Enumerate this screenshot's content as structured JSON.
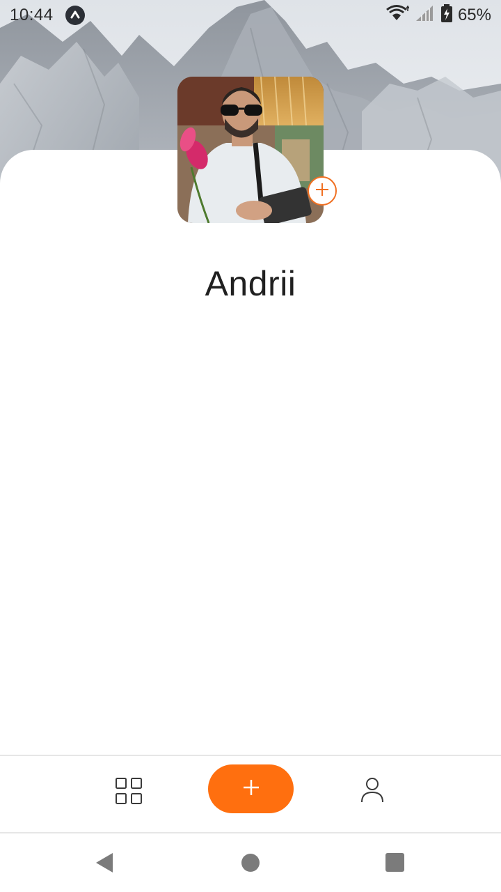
{
  "status_bar": {
    "time": "10:44",
    "battery": "65%",
    "icons": [
      "app-notification-icon",
      "wifi-icon",
      "signal-icon",
      "battery-charging-icon"
    ]
  },
  "profile": {
    "name": "Andrii",
    "avatar_icon": "user-photo",
    "add_photo_icon": "plus-circle-icon"
  },
  "bottom_nav": {
    "items": [
      {
        "icon": "grid-icon"
      },
      {
        "icon": "plus-icon"
      },
      {
        "icon": "user-icon"
      }
    ],
    "accent_color": "#ff6f0f"
  },
  "system_nav": {
    "icons": [
      "back-icon",
      "home-icon",
      "recents-icon"
    ]
  }
}
